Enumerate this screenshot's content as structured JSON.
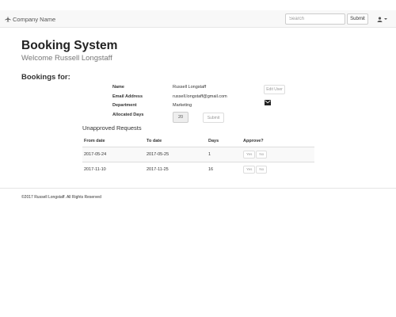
{
  "navbar": {
    "brand": "Company Name",
    "brand_icon": "plane-icon",
    "search_placeholder": "Search",
    "submit_label": "Submit",
    "user_icon": "user-icon"
  },
  "header": {
    "title": "Booking System",
    "welcome": "Welcome Russell Longstaff"
  },
  "bookings": {
    "heading": "Bookings for:",
    "fields": [
      {
        "label": "Name",
        "value": "Russell Longstaff"
      },
      {
        "label": "Email Address",
        "value": "russell.longstaff@gmail.com"
      },
      {
        "label": "Department",
        "value": "Marketing"
      },
      {
        "label": "Allocated Days",
        "value": "20"
      }
    ],
    "edit_user_label": "Edit User",
    "allocated_submit_label": "Submit"
  },
  "requests": {
    "heading": "Unapproved Requests",
    "columns": [
      "From date",
      "To date",
      "Days",
      "Approve?"
    ],
    "rows": [
      {
        "from": "2017-05-24",
        "to": "2017-05-25",
        "days": "1",
        "yes": "Yes",
        "no": "No"
      },
      {
        "from": "2017-11-10",
        "to": "2017-11-25",
        "days": "16",
        "yes": "Yes",
        "no": "No"
      }
    ]
  },
  "footer": {
    "text": "©2017 Russell Longstaff. All Rights Reserved"
  },
  "colors": {
    "navbar_bg": "#f8f8f8",
    "text": "#333333",
    "muted": "#777777",
    "row_stripe": "#f9f9f9"
  }
}
